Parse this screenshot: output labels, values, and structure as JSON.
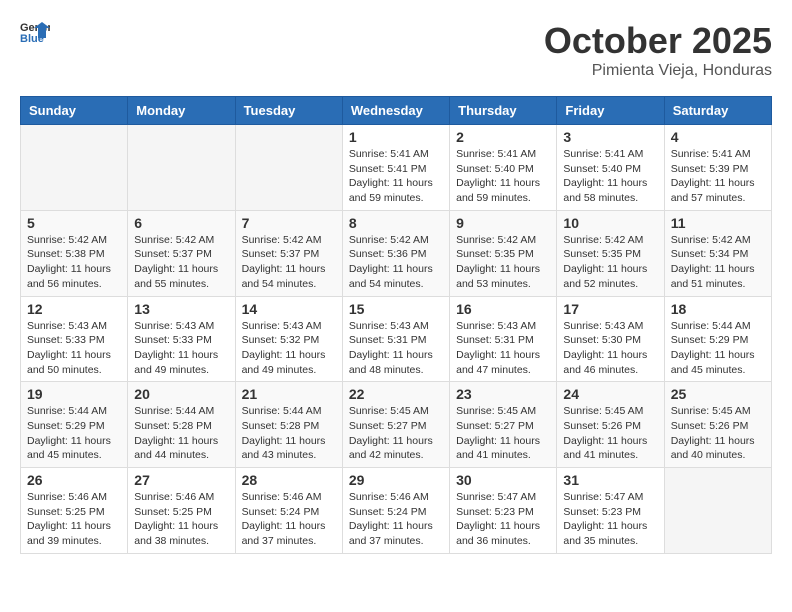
{
  "logo": {
    "general": "General",
    "blue": "Blue"
  },
  "title": "October 2025",
  "location": "Pimienta Vieja, Honduras",
  "weekdays": [
    "Sunday",
    "Monday",
    "Tuesday",
    "Wednesday",
    "Thursday",
    "Friday",
    "Saturday"
  ],
  "weeks": [
    [
      {
        "day": "",
        "info": ""
      },
      {
        "day": "",
        "info": ""
      },
      {
        "day": "",
        "info": ""
      },
      {
        "day": "1",
        "info": "Sunrise: 5:41 AM\nSunset: 5:41 PM\nDaylight: 11 hours\nand 59 minutes."
      },
      {
        "day": "2",
        "info": "Sunrise: 5:41 AM\nSunset: 5:40 PM\nDaylight: 11 hours\nand 59 minutes."
      },
      {
        "day": "3",
        "info": "Sunrise: 5:41 AM\nSunset: 5:40 PM\nDaylight: 11 hours\nand 58 minutes."
      },
      {
        "day": "4",
        "info": "Sunrise: 5:41 AM\nSunset: 5:39 PM\nDaylight: 11 hours\nand 57 minutes."
      }
    ],
    [
      {
        "day": "5",
        "info": "Sunrise: 5:42 AM\nSunset: 5:38 PM\nDaylight: 11 hours\nand 56 minutes."
      },
      {
        "day": "6",
        "info": "Sunrise: 5:42 AM\nSunset: 5:37 PM\nDaylight: 11 hours\nand 55 minutes."
      },
      {
        "day": "7",
        "info": "Sunrise: 5:42 AM\nSunset: 5:37 PM\nDaylight: 11 hours\nand 54 minutes."
      },
      {
        "day": "8",
        "info": "Sunrise: 5:42 AM\nSunset: 5:36 PM\nDaylight: 11 hours\nand 54 minutes."
      },
      {
        "day": "9",
        "info": "Sunrise: 5:42 AM\nSunset: 5:35 PM\nDaylight: 11 hours\nand 53 minutes."
      },
      {
        "day": "10",
        "info": "Sunrise: 5:42 AM\nSunset: 5:35 PM\nDaylight: 11 hours\nand 52 minutes."
      },
      {
        "day": "11",
        "info": "Sunrise: 5:42 AM\nSunset: 5:34 PM\nDaylight: 11 hours\nand 51 minutes."
      }
    ],
    [
      {
        "day": "12",
        "info": "Sunrise: 5:43 AM\nSunset: 5:33 PM\nDaylight: 11 hours\nand 50 minutes."
      },
      {
        "day": "13",
        "info": "Sunrise: 5:43 AM\nSunset: 5:33 PM\nDaylight: 11 hours\nand 49 minutes."
      },
      {
        "day": "14",
        "info": "Sunrise: 5:43 AM\nSunset: 5:32 PM\nDaylight: 11 hours\nand 49 minutes."
      },
      {
        "day": "15",
        "info": "Sunrise: 5:43 AM\nSunset: 5:31 PM\nDaylight: 11 hours\nand 48 minutes."
      },
      {
        "day": "16",
        "info": "Sunrise: 5:43 AM\nSunset: 5:31 PM\nDaylight: 11 hours\nand 47 minutes."
      },
      {
        "day": "17",
        "info": "Sunrise: 5:43 AM\nSunset: 5:30 PM\nDaylight: 11 hours\nand 46 minutes."
      },
      {
        "day": "18",
        "info": "Sunrise: 5:44 AM\nSunset: 5:29 PM\nDaylight: 11 hours\nand 45 minutes."
      }
    ],
    [
      {
        "day": "19",
        "info": "Sunrise: 5:44 AM\nSunset: 5:29 PM\nDaylight: 11 hours\nand 45 minutes."
      },
      {
        "day": "20",
        "info": "Sunrise: 5:44 AM\nSunset: 5:28 PM\nDaylight: 11 hours\nand 44 minutes."
      },
      {
        "day": "21",
        "info": "Sunrise: 5:44 AM\nSunset: 5:28 PM\nDaylight: 11 hours\nand 43 minutes."
      },
      {
        "day": "22",
        "info": "Sunrise: 5:45 AM\nSunset: 5:27 PM\nDaylight: 11 hours\nand 42 minutes."
      },
      {
        "day": "23",
        "info": "Sunrise: 5:45 AM\nSunset: 5:27 PM\nDaylight: 11 hours\nand 41 minutes."
      },
      {
        "day": "24",
        "info": "Sunrise: 5:45 AM\nSunset: 5:26 PM\nDaylight: 11 hours\nand 41 minutes."
      },
      {
        "day": "25",
        "info": "Sunrise: 5:45 AM\nSunset: 5:26 PM\nDaylight: 11 hours\nand 40 minutes."
      }
    ],
    [
      {
        "day": "26",
        "info": "Sunrise: 5:46 AM\nSunset: 5:25 PM\nDaylight: 11 hours\nand 39 minutes."
      },
      {
        "day": "27",
        "info": "Sunrise: 5:46 AM\nSunset: 5:25 PM\nDaylight: 11 hours\nand 38 minutes."
      },
      {
        "day": "28",
        "info": "Sunrise: 5:46 AM\nSunset: 5:24 PM\nDaylight: 11 hours\nand 37 minutes."
      },
      {
        "day": "29",
        "info": "Sunrise: 5:46 AM\nSunset: 5:24 PM\nDaylight: 11 hours\nand 37 minutes."
      },
      {
        "day": "30",
        "info": "Sunrise: 5:47 AM\nSunset: 5:23 PM\nDaylight: 11 hours\nand 36 minutes."
      },
      {
        "day": "31",
        "info": "Sunrise: 5:47 AM\nSunset: 5:23 PM\nDaylight: 11 hours\nand 35 minutes."
      },
      {
        "day": "",
        "info": ""
      }
    ]
  ]
}
